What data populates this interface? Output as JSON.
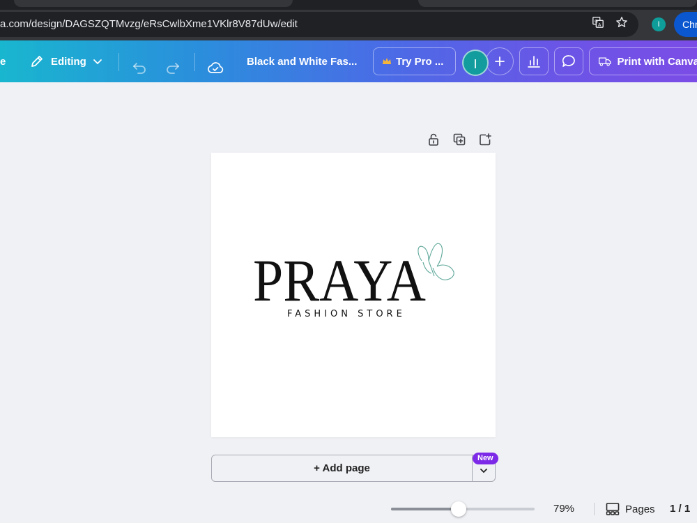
{
  "browser": {
    "url": "a.com/design/DAGSZQTMvzg/eRsCwlbXme1VKlr8V87dUw/edit",
    "profile_initial": "I",
    "chrome_badge": "Chro"
  },
  "header": {
    "left_partial": "e",
    "editing_label": "Editing",
    "doc_title": "Black and White Fas...",
    "try_pro_label": "Try Pro ...",
    "avatar_initial": "I",
    "print_label": "Print with Canva"
  },
  "design": {
    "logo_text": "PRAYA",
    "logo_subtitle": "FASHION STORE"
  },
  "add_page": {
    "label": "+ Add page",
    "badge": "New"
  },
  "footer": {
    "zoom": "79%",
    "zoom_level": 0.47,
    "pages_label": "Pages",
    "pages_count": "1 / 1"
  },
  "colors": {
    "header_start": "#19b6cf",
    "header_end": "#7b4de6",
    "new_badge": "#7d2ae8",
    "avatar": "#139c9e",
    "butterfly": "#5fa89a"
  }
}
